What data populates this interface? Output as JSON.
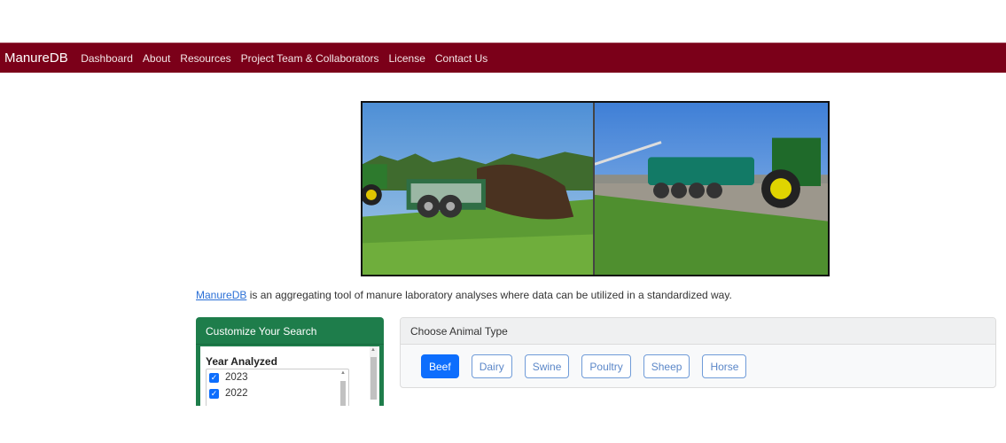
{
  "navbar": {
    "brand": "ManureDB",
    "links": [
      "Dashboard",
      "About",
      "Resources",
      "Project Team & Collaborators",
      "License",
      "Contact Us"
    ],
    "background_color": "#7b0019"
  },
  "hero": {
    "images": [
      {
        "name": "solid-manure-spreader-photo",
        "description": "Tractor pulling a solid manure spreader across a field"
      },
      {
        "name": "liquid-manure-tanker-photo",
        "description": "Tractor pulling a liquid manure tanker on a gravel field"
      }
    ]
  },
  "intro": {
    "link_text": "ManureDB",
    "text": " is an aggregating tool of manure laboratory analyses where data can be utilized in a standardized way."
  },
  "search_panel": {
    "title": "Customize Your Search",
    "header_color": "#1e7d4b",
    "section_title": "Year Analyzed",
    "years": [
      {
        "label": "2023",
        "checked": true
      },
      {
        "label": "2022",
        "checked": true
      }
    ]
  },
  "animal_panel": {
    "title": "Choose Animal Type",
    "options": [
      "Beef",
      "Dairy",
      "Swine",
      "Poultry",
      "Sheep",
      "Horse"
    ],
    "selected": "Beef",
    "accent_color": "#0d6efd"
  }
}
